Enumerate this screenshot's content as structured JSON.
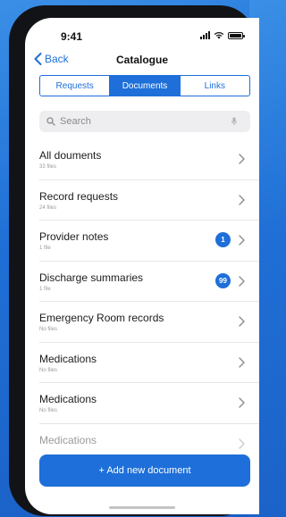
{
  "status": {
    "time": "9:41"
  },
  "nav": {
    "back_label": "Back",
    "title": "Catalogue"
  },
  "tabs": [
    {
      "label": "Requests",
      "active": false
    },
    {
      "label": "Documents",
      "active": true
    },
    {
      "label": "Links",
      "active": false
    }
  ],
  "search": {
    "placeholder": "Search"
  },
  "documents": [
    {
      "title": "All douments",
      "subtitle": "33 files"
    },
    {
      "title": "Record requests",
      "subtitle": "24 files"
    },
    {
      "title": "Provider notes",
      "subtitle": "1 file",
      "badge": "1"
    },
    {
      "title": "Discharge summaries",
      "subtitle": "1 file",
      "badge": "99"
    },
    {
      "title": "Emergency Room records",
      "subtitle": "No files"
    },
    {
      "title": "Medications",
      "subtitle": "No files"
    },
    {
      "title": "Medications",
      "subtitle": "No files"
    },
    {
      "title": "Medications",
      "subtitle": ""
    }
  ],
  "add_button_label": "+ Add new document",
  "colors": {
    "accent": "#1e6fd9",
    "background": "#2a7de0"
  }
}
